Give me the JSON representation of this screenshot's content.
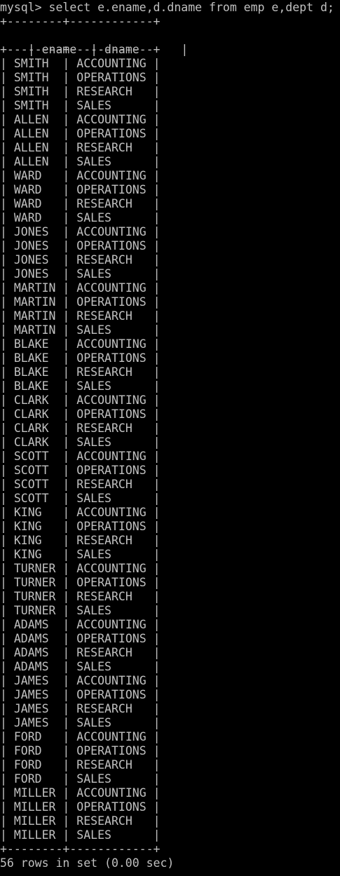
{
  "terminal": {
    "command_line": "mysql> select e.ename,d.dname from emp e,dept d;",
    "border_line": "+--------+------------+",
    "header": {
      "col1": "ename",
      "col2": "dname"
    },
    "rows": [
      [
        "SMITH",
        "ACCOUNTING"
      ],
      [
        "SMITH",
        "OPERATIONS"
      ],
      [
        "SMITH",
        "RESEARCH"
      ],
      [
        "SMITH",
        "SALES"
      ],
      [
        "ALLEN",
        "ACCOUNTING"
      ],
      [
        "ALLEN",
        "OPERATIONS"
      ],
      [
        "ALLEN",
        "RESEARCH"
      ],
      [
        "ALLEN",
        "SALES"
      ],
      [
        "WARD",
        "ACCOUNTING"
      ],
      [
        "WARD",
        "OPERATIONS"
      ],
      [
        "WARD",
        "RESEARCH"
      ],
      [
        "WARD",
        "SALES"
      ],
      [
        "JONES",
        "ACCOUNTING"
      ],
      [
        "JONES",
        "OPERATIONS"
      ],
      [
        "JONES",
        "RESEARCH"
      ],
      [
        "JONES",
        "SALES"
      ],
      [
        "MARTIN",
        "ACCOUNTING"
      ],
      [
        "MARTIN",
        "OPERATIONS"
      ],
      [
        "MARTIN",
        "RESEARCH"
      ],
      [
        "MARTIN",
        "SALES"
      ],
      [
        "BLAKE",
        "ACCOUNTING"
      ],
      [
        "BLAKE",
        "OPERATIONS"
      ],
      [
        "BLAKE",
        "RESEARCH"
      ],
      [
        "BLAKE",
        "SALES"
      ],
      [
        "CLARK",
        "ACCOUNTING"
      ],
      [
        "CLARK",
        "OPERATIONS"
      ],
      [
        "CLARK",
        "RESEARCH"
      ],
      [
        "CLARK",
        "SALES"
      ],
      [
        "SCOTT",
        "ACCOUNTING"
      ],
      [
        "SCOTT",
        "OPERATIONS"
      ],
      [
        "SCOTT",
        "RESEARCH"
      ],
      [
        "SCOTT",
        "SALES"
      ],
      [
        "KING",
        "ACCOUNTING"
      ],
      [
        "KING",
        "OPERATIONS"
      ],
      [
        "KING",
        "RESEARCH"
      ],
      [
        "KING",
        "SALES"
      ],
      [
        "TURNER",
        "ACCOUNTING"
      ],
      [
        "TURNER",
        "OPERATIONS"
      ],
      [
        "TURNER",
        "RESEARCH"
      ],
      [
        "TURNER",
        "SALES"
      ],
      [
        "ADAMS",
        "ACCOUNTING"
      ],
      [
        "ADAMS",
        "OPERATIONS"
      ],
      [
        "ADAMS",
        "RESEARCH"
      ],
      [
        "ADAMS",
        "SALES"
      ],
      [
        "JAMES",
        "ACCOUNTING"
      ],
      [
        "JAMES",
        "OPERATIONS"
      ],
      [
        "JAMES",
        "RESEARCH"
      ],
      [
        "JAMES",
        "SALES"
      ],
      [
        "FORD",
        "ACCOUNTING"
      ],
      [
        "FORD",
        "OPERATIONS"
      ],
      [
        "FORD",
        "RESEARCH"
      ],
      [
        "FORD",
        "SALES"
      ],
      [
        "MILLER",
        "ACCOUNTING"
      ],
      [
        "MILLER",
        "OPERATIONS"
      ],
      [
        "MILLER",
        "RESEARCH"
      ],
      [
        "MILLER",
        "SALES"
      ]
    ],
    "footer": "56 rows in set (0.00 sec)",
    "colors": {
      "background": "#000000",
      "text": "#c0c0c0"
    }
  }
}
